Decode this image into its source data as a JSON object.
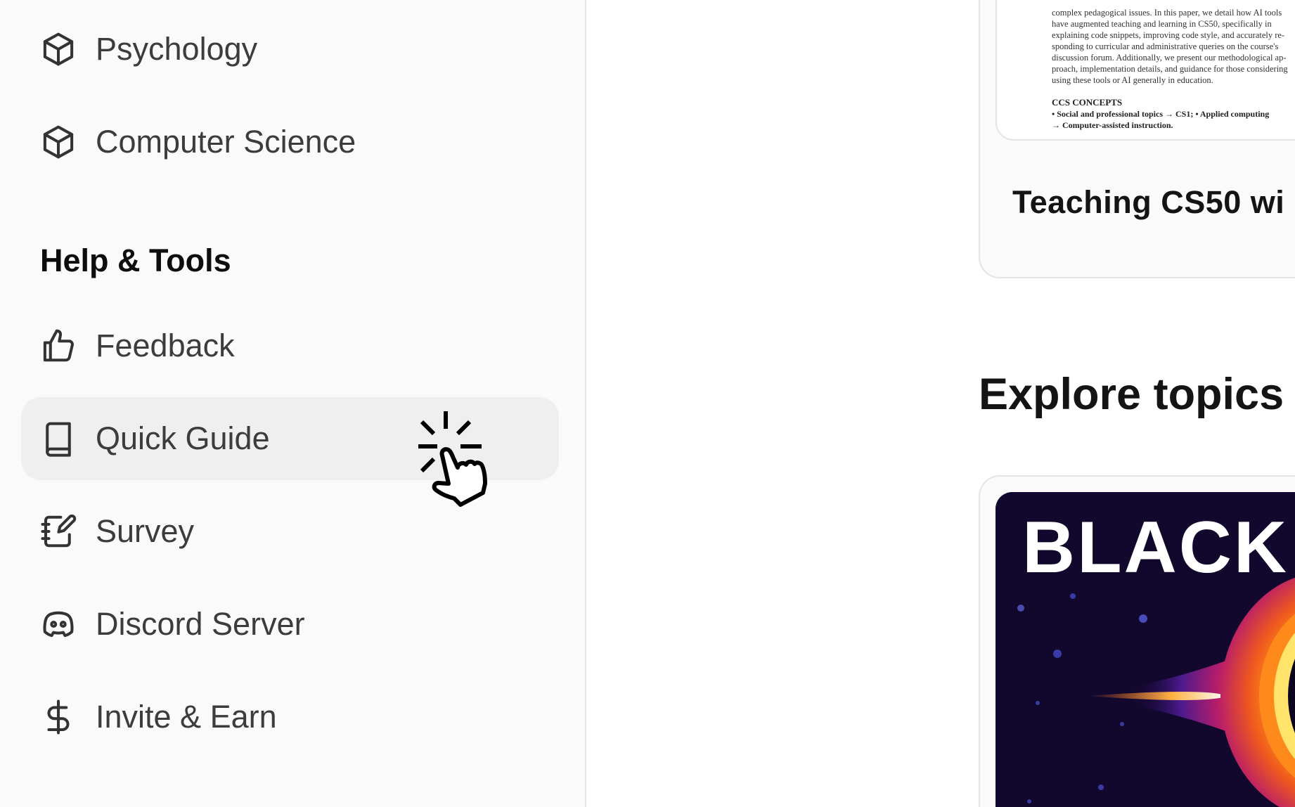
{
  "sidebar": {
    "items_top": [
      {
        "label": "Psychology",
        "icon": "cube-icon"
      },
      {
        "label": "Computer Science",
        "icon": "cube-icon"
      }
    ],
    "section_title": "Help & Tools",
    "tools": [
      {
        "label": "Feedback",
        "icon": "thumbs-up-icon"
      },
      {
        "label": "Quick Guide",
        "icon": "book-icon",
        "active": true
      },
      {
        "label": "Survey",
        "icon": "notebook-pen-icon"
      },
      {
        "label": "Discord Server",
        "icon": "discord-icon"
      },
      {
        "label": "Invite & Earn",
        "icon": "dollar-icon"
      }
    ]
  },
  "main": {
    "paper_card": {
      "abstract_lines": [
        "complex pedagogical issues. In this paper, we detail how AI tools",
        "have augmented teaching and learning in CS50, specifically in",
        "explaining code snippets, improving code style, and accurately re-",
        "sponding to curricular and administrative queries on the course's",
        "discussion forum. Additionally, we present our methodological ap-",
        "proach, implementation details, and guidance for those considering",
        "using these tools or AI generally in education."
      ],
      "ccs_heading": "CCS CONCEPTS",
      "ccs_lines": [
        "• Social and professional topics → CS1; • Applied computing",
        "→ Computer-assisted instruction."
      ],
      "title": "Teaching CS50 wi"
    },
    "explore_heading": "Explore topics",
    "topic_card": {
      "image_text": "BLACK"
    }
  },
  "colors": {
    "sidebar_bg": "#fafafa",
    "active_item_bg": "#efefef",
    "text_primary": "#3c3c3c",
    "topic_image_bg": "#12082e"
  }
}
